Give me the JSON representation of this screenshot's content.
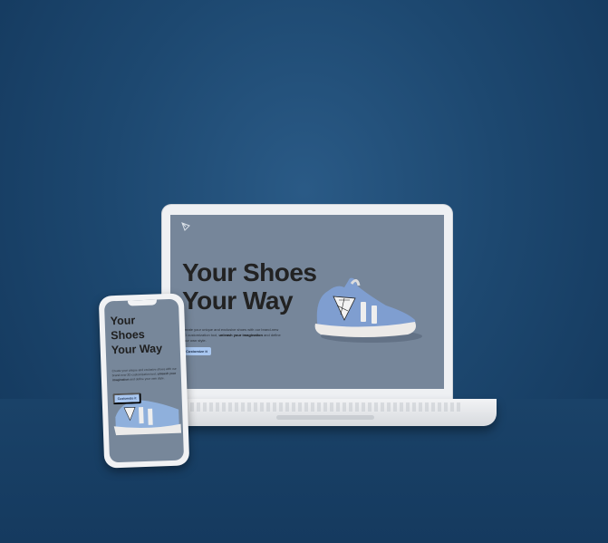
{
  "website": {
    "headline_line1": "Your Shoes",
    "headline_line2": "Your Way",
    "description_pre": "Create your unique and exclusive shoes with our brand-new 3D customization tool,",
    "description_bold": "unleash your imagination",
    "description_post": "and define your own style.",
    "cta_label": "Customize it"
  },
  "phone_site": {
    "headline_line1": "Your",
    "headline_line2": "Shoes",
    "headline_line3": "Your Way",
    "description_pre": "Create your unique and exclusive shoes with our brand-new 3D customization tool,",
    "description_bold": "unleash your imagination",
    "description_post": "and define your own style.",
    "cta_label": "Customize it"
  },
  "colors": {
    "background": "#1b4468",
    "screen": "#76869a",
    "cta": "#a9c7f0"
  }
}
